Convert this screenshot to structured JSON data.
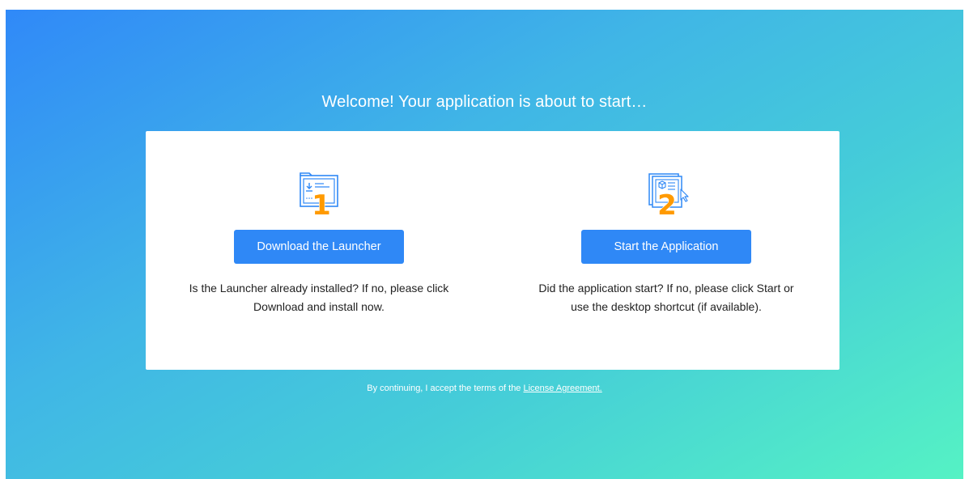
{
  "page": {
    "welcome_text": "Welcome! Your application is about to start…"
  },
  "steps": [
    {
      "number": "1",
      "icon": "folder-download-icon",
      "button_label": "Download the Launcher",
      "description_line1": "Is the Launcher already installed? If no, please click",
      "description_line2": "Download and install now."
    },
    {
      "number": "2",
      "icon": "app-window-cursor-icon",
      "button_label": "Start the Application",
      "description_line1": "Did the application start? If no, please click Start or",
      "description_line2": "use the desktop shortcut (if available)."
    }
  ],
  "footer": {
    "prefix": "By continuing, I accept the terms of the",
    "link_label": "License Agreement."
  },
  "colors": {
    "gradient_start": "#3089f8",
    "gradient_end": "#55f2c4",
    "button": "#2f88f6",
    "icon_line": "#2f88f6",
    "step_number": "#ff9a00"
  }
}
